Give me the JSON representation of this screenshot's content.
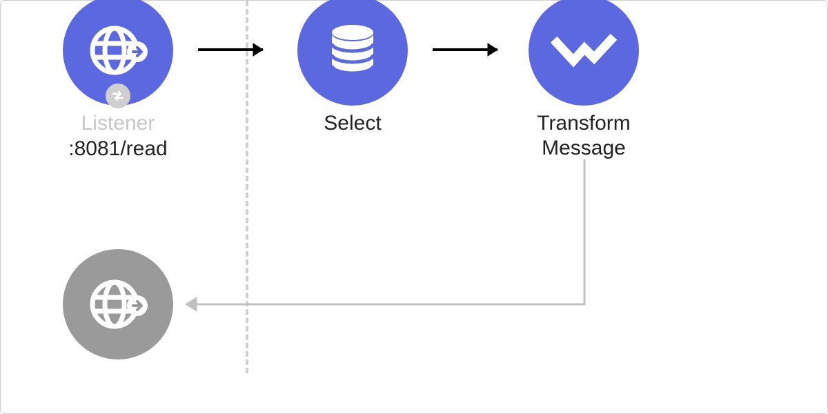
{
  "colors": {
    "node_blue": "#5b68e0",
    "node_gray": "#9a9a9a",
    "divider": "#d0d0d0",
    "return_arrow": "#c0c0c0",
    "text": "#222222",
    "text_muted": "#c7c7c7"
  },
  "nodes": {
    "listener": {
      "label": "Listener",
      "sublabel": ":8081/read",
      "icon": "globe-arrow-icon",
      "badge": "bidirectional-arrows-icon",
      "color": "blue"
    },
    "select": {
      "label": "Select",
      "icon": "database-icon",
      "color": "blue"
    },
    "transform": {
      "label": "Transform\nMessage",
      "icon": "chevron-transform-icon",
      "color": "blue"
    },
    "response": {
      "label": "",
      "icon": "globe-arrow-icon",
      "color": "gray"
    }
  }
}
